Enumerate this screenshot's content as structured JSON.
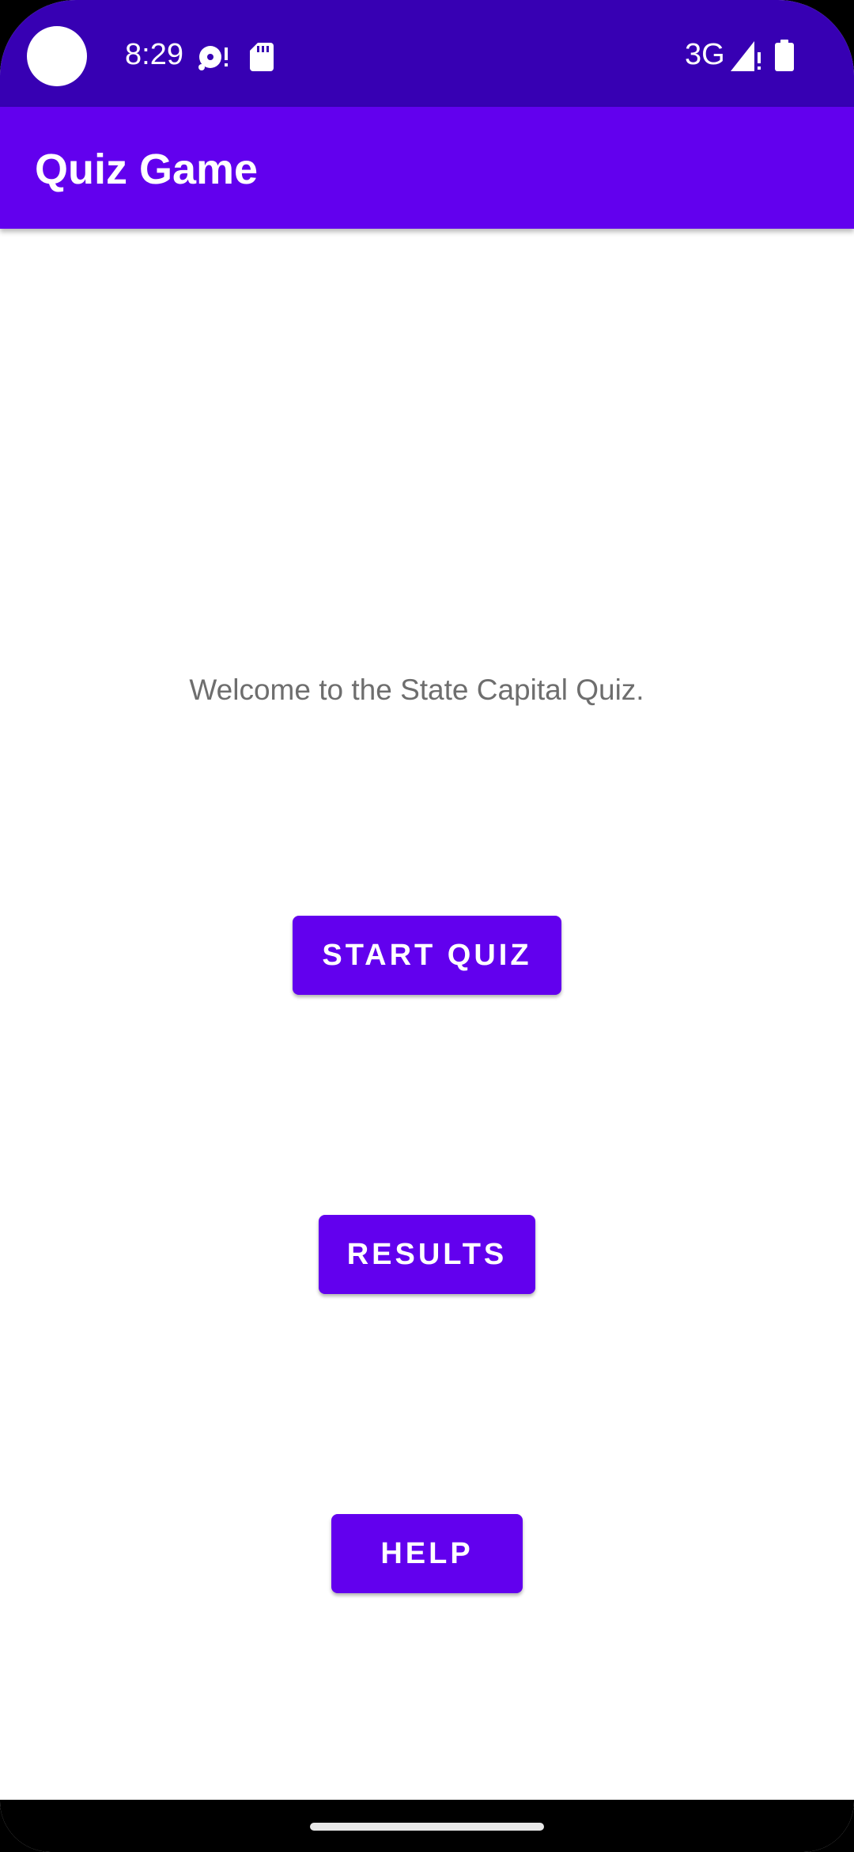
{
  "status_bar": {
    "time": "8:29",
    "network": "3G",
    "icons": [
      "camera-cutout",
      "media-sync-icon",
      "sd-card-icon",
      "signal-icon",
      "battery-icon"
    ]
  },
  "app_bar": {
    "title": "Quiz Game"
  },
  "main": {
    "welcome_text": "Welcome to the State Capital Quiz.",
    "buttons": {
      "start": "START QUIZ",
      "results": "RESULTS",
      "help": "HELP"
    }
  },
  "colors": {
    "status_bar": "#3700b3",
    "primary": "#6200ee",
    "text_secondary": "#6e6e6e",
    "background": "#ffffff"
  }
}
